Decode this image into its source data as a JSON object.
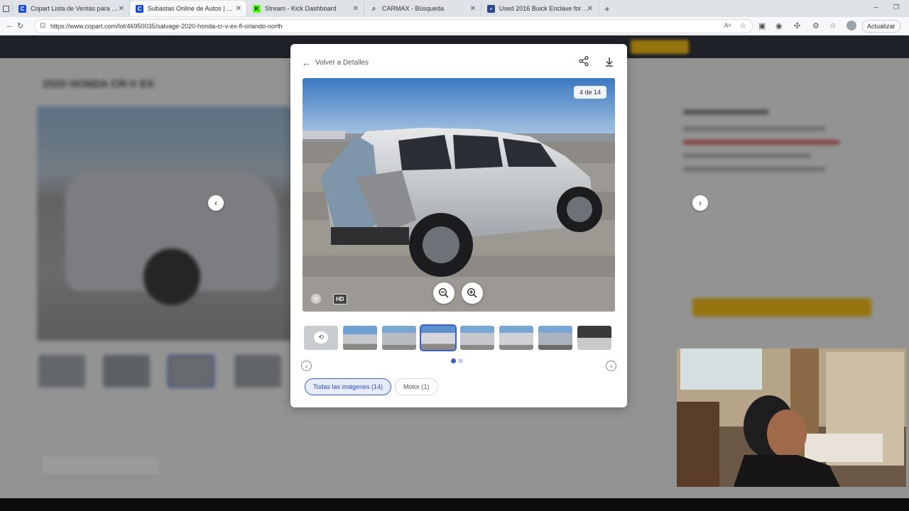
{
  "browser": {
    "tabs": [
      {
        "title": "Copart Lista de Ventas para - Sub",
        "favicon": "copart-icon",
        "active": false
      },
      {
        "title": "Subastas Online de Autos | Autos",
        "favicon": "copart-icon",
        "active": true
      },
      {
        "title": "Stream - Kick Dashboard",
        "favicon": "kick-icon",
        "active": false
      },
      {
        "title": "CARMAX - Búsqueda",
        "favicon": "search-icon",
        "active": false
      },
      {
        "title": "Used 2016 Buick Enclave for sale",
        "favicon": "cars-icon",
        "active": false
      }
    ],
    "url": "https://www.copart.com/lot/46950035/salvage-2020-honda-cr-v-ex-fl-orlando-north",
    "update_label": "Actualizar"
  },
  "background": {
    "title": "2020 HONDA CR-V EX"
  },
  "modal": {
    "back_label": "Volver a Detalles",
    "counter": "4 de 14",
    "hd_label": "HD",
    "filters": [
      {
        "label": "Todas las imágenes (14)",
        "active": true
      },
      {
        "label": "Motor (1)",
        "active": false
      }
    ],
    "thumbnail_count": 8,
    "selected_thumbnail": 4
  },
  "colors": {
    "accent": "#3a5fd0",
    "copart_blue": "#1a4bd6",
    "kick_green": "#53fc18"
  }
}
